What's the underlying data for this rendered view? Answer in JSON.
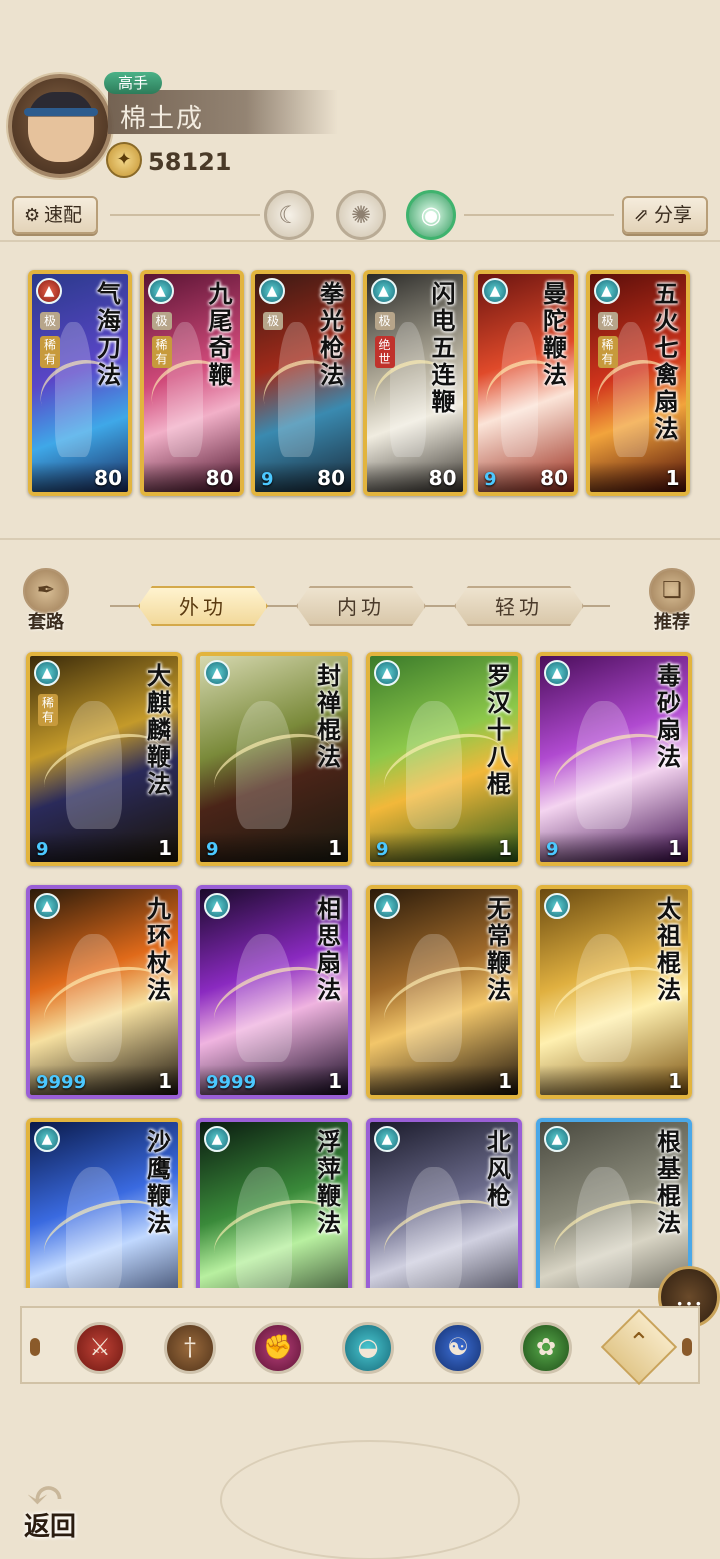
{
  "player": {
    "rank": "高手",
    "name": "棉土成",
    "power": "58121"
  },
  "top_buttons": {
    "quick_equip": "速配",
    "share": "分享"
  },
  "equipped": [
    {
      "title": "气海刀法",
      "level": "80",
      "badge_color": "red",
      "tags": [
        "极",
        "稀有"
      ],
      "stars": "",
      "bg": "linear-gradient(160deg,#2a3a8a,#5a46c8 45%,#3fa8e8 70%,#1a2a5e)"
    },
    {
      "title": "九尾奇鞭",
      "level": "80",
      "badge_color": "teal",
      "tags": [
        "极",
        "稀有"
      ],
      "stars": "",
      "bg": "linear-gradient(160deg,#5a1434,#d04a7a 45%,#f2b0c8 65%,#4a1028)"
    },
    {
      "title": "拳光枪法",
      "level": "80",
      "badge_color": "teal",
      "tags": [
        "极"
      ],
      "stars": "9",
      "bg": "linear-gradient(160deg,#3a1a14,#a02a1a 40%,#3a8ab0 65%,#1a2a3a)"
    },
    {
      "title": "闪电五连鞭",
      "level": "80",
      "badge_color": "teal",
      "tags": [
        "极",
        "绝世"
      ],
      "stars": "",
      "bg": "linear-gradient(160deg,#2a2a28,#b4ae9c 45%,#f0ece0 65%,#3a3630)"
    },
    {
      "title": "曼陀鞭法",
      "level": "80",
      "badge_color": "teal",
      "tags": [],
      "stars": "9",
      "bg": "linear-gradient(160deg,#6a1410,#e04a2a 40%,#fbe4d8 60%,#9a2a1a)"
    },
    {
      "title": "五火七禽扇法",
      "level": "1",
      "badge_color": "teal",
      "tags": [
        "极",
        "稀有"
      ],
      "stars": "",
      "bg": "linear-gradient(160deg,#5a0e0a,#d0341c 45%,#f2a43c 65%,#4a0a06)"
    }
  ],
  "tabs": {
    "left": "套路",
    "right": "推荐",
    "items": [
      "外功",
      "内功",
      "轻功"
    ],
    "active": 0
  },
  "skills": [
    {
      "title": "大麒麟鞭法",
      "level": "1",
      "stars": "9",
      "frame": "gold",
      "tag": "稀有",
      "bg": "linear-gradient(160deg,#3a2a0a,#c49a2a 40%,#2a2a5a 60%,#1a1406)"
    },
    {
      "title": "封禅棍法",
      "level": "1",
      "stars": "9",
      "frame": "gold",
      "tag": "",
      "bg": "linear-gradient(160deg,#d6d8b0,#7a8a3a 40%,#4a2418 60%,#1a1a10)"
    },
    {
      "title": "罗汉十八棍",
      "level": "1",
      "stars": "9",
      "frame": "gold",
      "tag": "",
      "bg": "linear-gradient(160deg,#3a7a2a,#8cc84a 40%,#f2b83a 60%,#2a5a1a)"
    },
    {
      "title": "毒砂扇法",
      "level": "1",
      "stars": "9",
      "frame": "gold",
      "tag": "",
      "bg": "linear-gradient(160deg,#4a0e5a,#b04ad0 40%,#f4d4f0 60%,#3a0a4a)"
    },
    {
      "title": "九环杖法",
      "level": "1",
      "stars": "9999",
      "frame": "purple",
      "tag": "",
      "bg": "linear-gradient(160deg,#2a1a0a,#e06a1a 40%,#f6e0a0 60%,#1a120a)"
    },
    {
      "title": "相思扇法",
      "level": "1",
      "stars": "9999",
      "frame": "purple",
      "tag": "",
      "bg": "linear-gradient(160deg,#1a0a2a,#8a2ac0 40%,#f0b4e0 60%,#140820)"
    },
    {
      "title": "无常鞭法",
      "level": "1",
      "stars": "",
      "frame": "gold",
      "tag": "",
      "bg": "linear-gradient(160deg,#2a1a0a,#a06a2a 40%,#f2c66a 60%,#1a1008)"
    },
    {
      "title": "太祖棍法",
      "level": "1",
      "stars": "",
      "frame": "gold",
      "tag": "",
      "bg": "linear-gradient(160deg,#6a4a10,#e0b040 40%,#fff0b0 60%,#7a5210)"
    },
    {
      "title": "沙鹰鞭法",
      "level": "",
      "stars": "",
      "frame": "gold",
      "tag": "",
      "bg": "linear-gradient(160deg,#0a1a4a,#3a6ae0 40%,#c0d8ff 60%,#0a1432)"
    },
    {
      "title": "浮萍鞭法",
      "level": "",
      "stars": "",
      "frame": "purple",
      "tag": "",
      "bg": "linear-gradient(160deg,#0a1a10,#3a8a3a 40%,#b8f0a0 60%,#0a140a)"
    },
    {
      "title": "北风枪",
      "level": "",
      "stars": "",
      "frame": "purple",
      "tag": "",
      "bg": "linear-gradient(160deg,#1a1a2a,#6a6a8a 40%,#d0d0e0 60%,#121220)"
    },
    {
      "title": "根基棍法",
      "level": "",
      "stars": "",
      "frame": "blue",
      "tag": "",
      "bg": "linear-gradient(160deg,#4a4a40,#8a8a7a 40%,#d8d4c4 60%,#3a3a32)"
    }
  ],
  "filters": [
    "blade-icon",
    "sword-icon",
    "fist-icon",
    "fan-icon",
    "taiji-icon",
    "wind-icon"
  ],
  "back_label": "返回",
  "colors": {
    "background": "#ece2cf",
    "gold_frame": "#e2b43e",
    "purple_frame": "#9a5fd6",
    "blue_frame": "#4aa8e8",
    "active_tab": "#f2d99b"
  }
}
